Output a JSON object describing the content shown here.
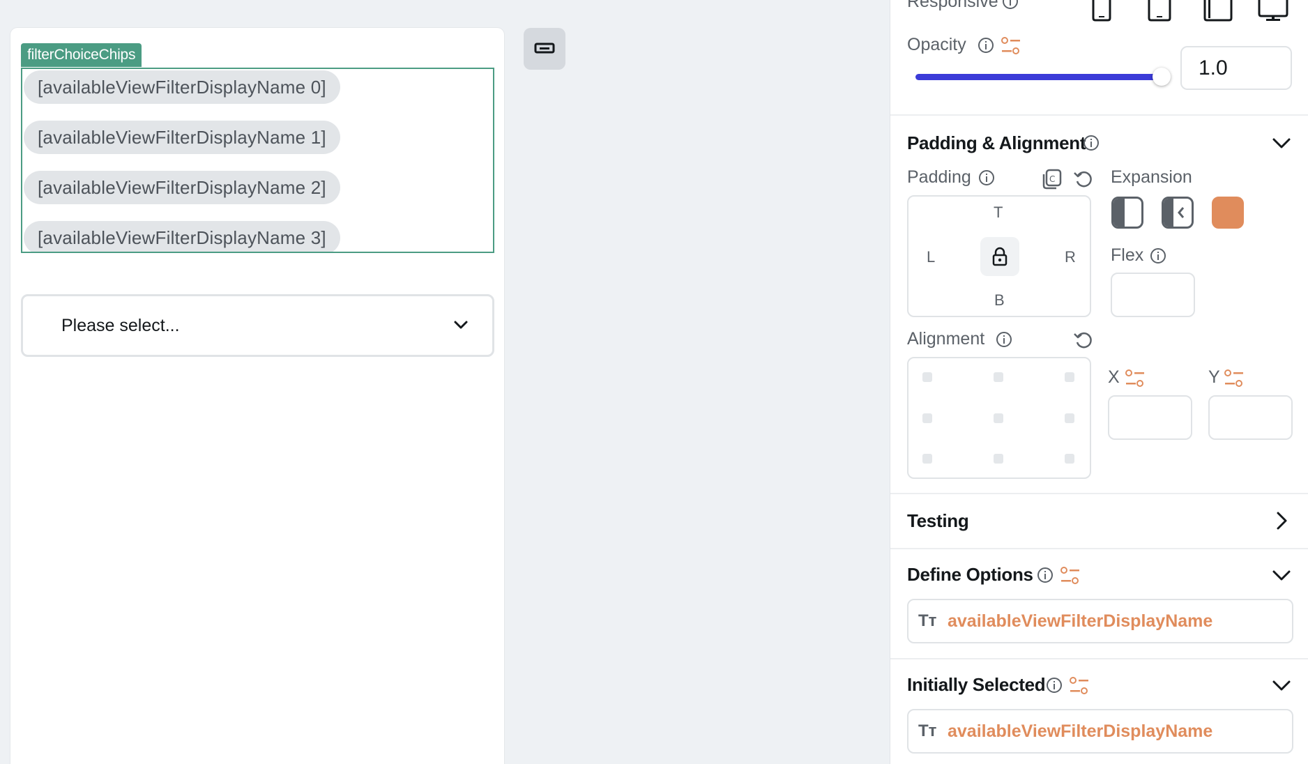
{
  "canvas": {
    "widget_tag": "filterChoiceChips",
    "chips": [
      "[availableViewFilterDisplayName 0]",
      "[availableViewFilterDisplayName 1]",
      "[availableViewFilterDisplayName 2]",
      "[availableViewFilterDisplayName 3]"
    ],
    "dropdown_placeholder": "Please select..."
  },
  "panel": {
    "responsive": {
      "label": "Responsive",
      "devices": [
        "phone-icon",
        "tablet-icon",
        "tablet-landscape-icon",
        "desktop-icon"
      ]
    },
    "opacity": {
      "label": "Opacity",
      "value": "1.0",
      "slider_fraction": 1.0
    },
    "padding_alignment": {
      "title": "Padding & Alignment",
      "padding_label": "Padding",
      "pad_sides": {
        "top": "T",
        "left": "L",
        "right": "R",
        "bottom": "B"
      },
      "expansion_label": "Expansion",
      "flex_label": "Flex",
      "alignment_label": "Alignment",
      "x_label": "X",
      "y_label": "Y"
    },
    "testing": {
      "title": "Testing"
    },
    "define_options": {
      "title": "Define Options",
      "value": "availableViewFilterDisplayName"
    },
    "initially_selected": {
      "title": "Initially Selected",
      "value": "availableViewFilterDisplayName"
    },
    "text_type_glyph": "Tт",
    "accent_color": "#e08c5c",
    "selection_color": "#4b9c83",
    "slider_color": "#3b3bd8"
  }
}
